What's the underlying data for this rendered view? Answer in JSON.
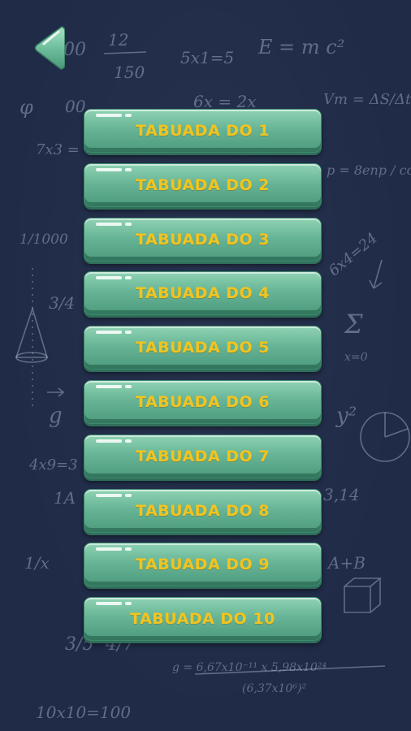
{
  "screen": {
    "back_icon": "back-arrow-icon",
    "colors": {
      "background": "#1f2b47",
      "button": "#67b596",
      "label": "#f2c41f"
    }
  },
  "chalkboard": {
    "formulas": [
      "00",
      "12",
      "150",
      "5x1=5",
      "E = m c²",
      "φ",
      "00",
      "6x = 2x",
      "Vm = ΔS/Δt",
      "7x3 =",
      "p = 8enp / cosφ",
      "1/1000",
      "6x4=24",
      "3/4",
      "Σ",
      "x=0",
      "g",
      "y²",
      "4x9=3",
      "1A",
      "3,14",
      "1/x",
      "A+B",
      "3/5",
      "4/7",
      "g = 6,67x10⁻¹¹ x 5,98x10²⁴",
      "(6,37x10⁶)²",
      "10x10=100"
    ]
  },
  "menu": {
    "items": [
      {
        "label": "TABUADA DO 1"
      },
      {
        "label": "TABUADA DO 2"
      },
      {
        "label": "TABUADA DO 3"
      },
      {
        "label": "TABUADA DO 4"
      },
      {
        "label": "TABUADA DO 5"
      },
      {
        "label": "TABUADA DO 6"
      },
      {
        "label": "TABUADA DO 7"
      },
      {
        "label": "TABUADA DO 8"
      },
      {
        "label": "TABUADA DO 9"
      },
      {
        "label": "TABUADA DO 10"
      }
    ]
  }
}
